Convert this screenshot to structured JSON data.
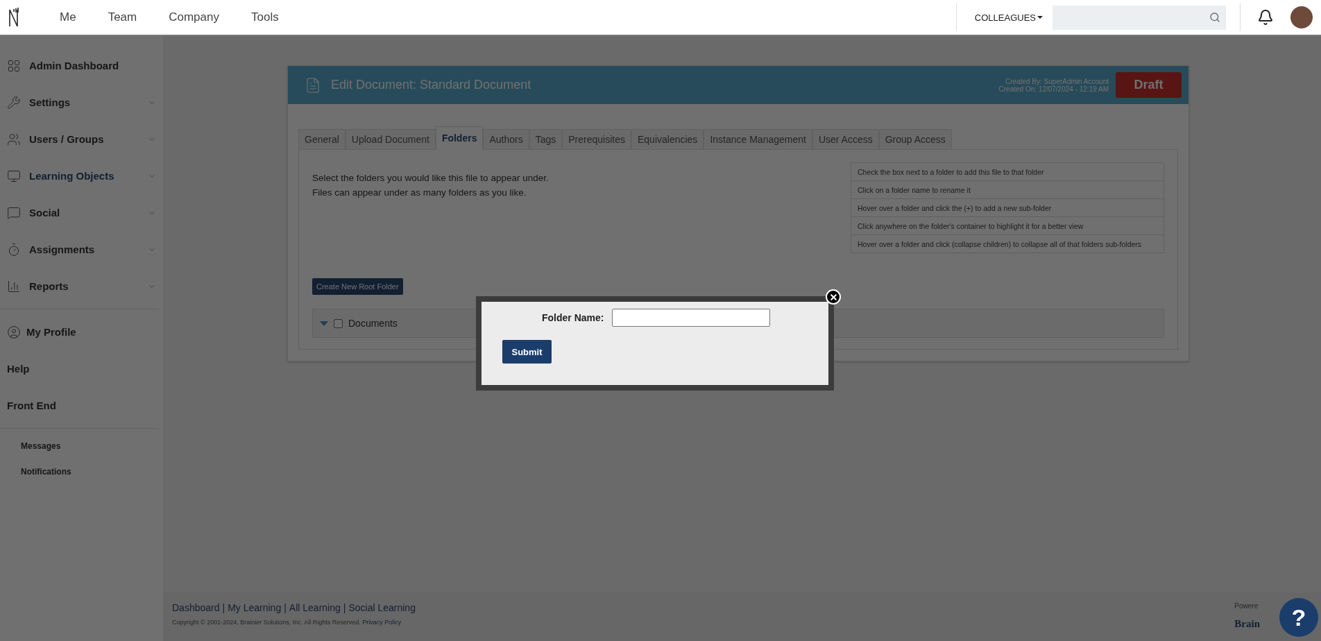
{
  "top_nav": {
    "links": [
      "Me",
      "Team",
      "Company",
      "Tools"
    ],
    "colleagues_menu": "COLLEAGUES"
  },
  "sidebar": {
    "main_items": [
      {
        "label": "Admin Dashboard",
        "selected": false
      },
      {
        "label": "Settings",
        "selected": false,
        "expanded": false
      },
      {
        "label": "Users / Groups",
        "selected": false,
        "expanded": false
      },
      {
        "label": "Learning Objects",
        "selected": true,
        "expanded": false
      },
      {
        "label": "Social",
        "selected": false,
        "expanded": false
      },
      {
        "label": "Assignments",
        "selected": false,
        "expanded": false
      },
      {
        "label": "Reports",
        "selected": false,
        "expanded": false
      }
    ],
    "account_items": [
      "My Profile",
      "Help",
      "Front End"
    ],
    "sub_items": [
      "Messages",
      "Notifications"
    ]
  },
  "document": {
    "title": "Edit Document: Standard Document",
    "created_by": "Created By: SuperAdmin Account",
    "created_on": "Created On: 12/07/2024 - 12:19 AM",
    "status": "Draft",
    "tabs": [
      {
        "label": "General",
        "selected": false
      },
      {
        "label": "Upload Document",
        "selected": false
      },
      {
        "label": "Folders",
        "selected": true
      },
      {
        "label": "Authors",
        "selected": false
      },
      {
        "label": "Tags",
        "selected": false
      },
      {
        "label": "Prerequisites",
        "selected": false
      },
      {
        "label": "Equivalencies",
        "selected": false
      },
      {
        "label": "Instance Management",
        "selected": false
      },
      {
        "label": "User Access",
        "selected": false
      },
      {
        "label": "Group Access",
        "selected": false
      }
    ],
    "instructions": [
      "Select the folders you would like this file to appear under.",
      "Files can appear under as many folders as you like."
    ],
    "tips": [
      "Check the box next to a folder to add this file to that folder",
      "Click on a folder name to rename it",
      "Hover over a folder and click the (+) to add a new sub-folder",
      "Click anywhere on the folder's container to highlight it for a better view",
      "Hover over a folder and click (collapse children) to collapse all of that folders sub-folders"
    ],
    "create_button": "Create New Root Folder",
    "folders": [
      {
        "name": "Documents",
        "expanded": true,
        "checked": false
      }
    ]
  },
  "modal": {
    "label": "Folder Name:",
    "submit": "Submit"
  },
  "footer": {
    "links": [
      "Dashboard",
      "My Learning",
      "All Learning",
      "Social Learning"
    ],
    "separator": "|",
    "copyright": "Copyright © 2001-2024, Brainier Solutions, Inc. All Rights Reserved.",
    "privacy": "Privacy Policy",
    "powered": "Powere",
    "brand": "Brain"
  },
  "help_button": "?"
}
